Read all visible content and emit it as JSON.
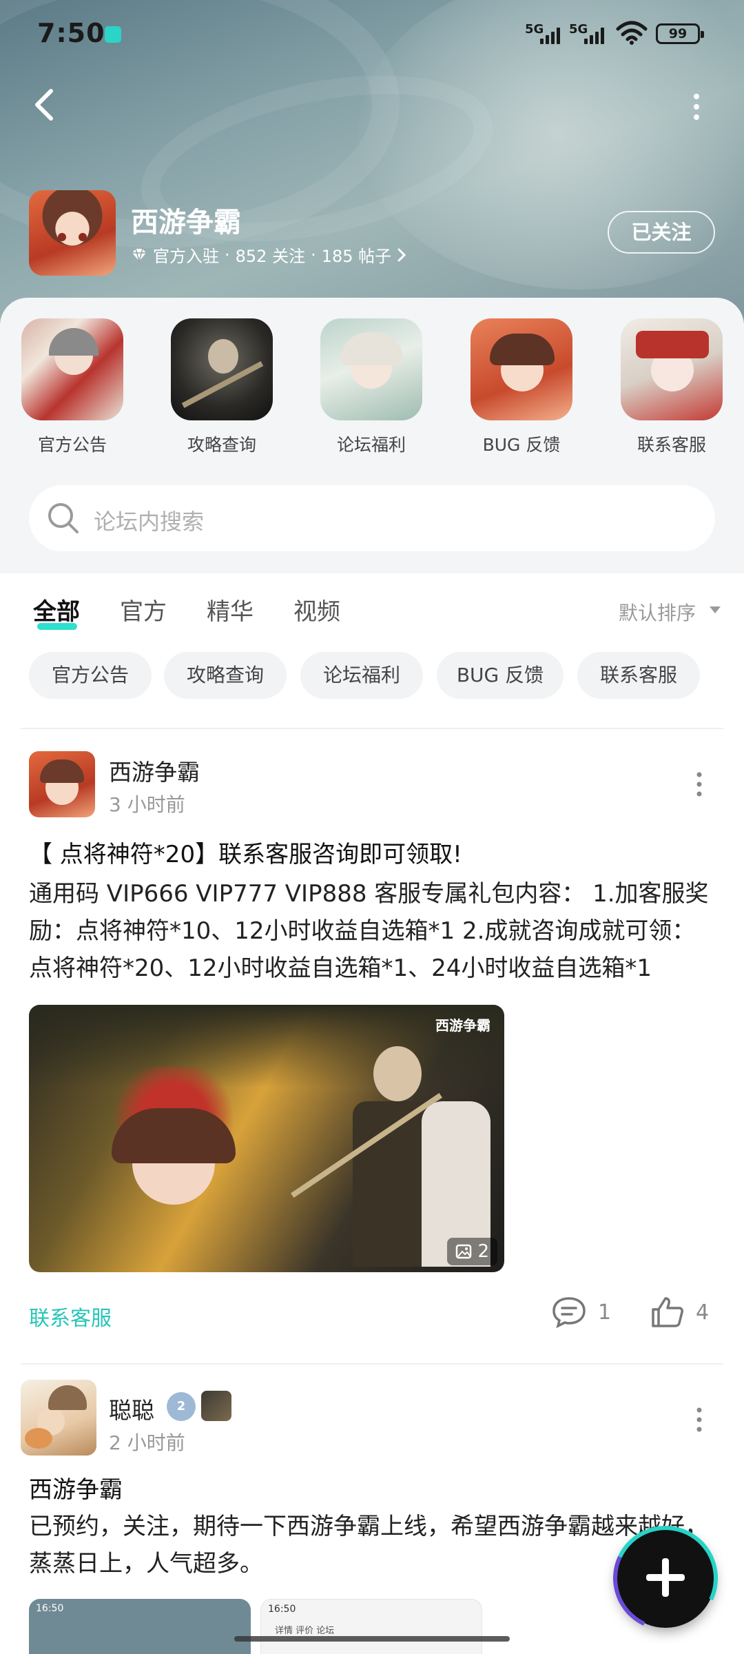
{
  "status_bar": {
    "time": "7:50",
    "signal1": "5G",
    "signal2": "5G",
    "battery": "99"
  },
  "header": {
    "forum_title": "西游争霸",
    "official_label": "官方入驻",
    "followers": "852 关注",
    "posts": "185 帖子",
    "follow_button": "已关注",
    "separator": "·"
  },
  "categories": [
    {
      "label": "官方公告",
      "color": "#c98a7c"
    },
    {
      "label": "攻略查询",
      "color": "#2a2a2a"
    },
    {
      "label": "论坛福利",
      "color": "#c6d8cf"
    },
    {
      "label": "BUG 反馈",
      "color": "#d66a48"
    },
    {
      "label": "联系客服",
      "color": "#e8e0d8"
    }
  ],
  "search": {
    "placeholder": "论坛内搜索"
  },
  "tabs": {
    "items": [
      "全部",
      "官方",
      "精华",
      "视频"
    ],
    "active": "全部",
    "sort_label": "默认排序"
  },
  "chips": [
    "官方公告",
    "攻略查询",
    "论坛福利",
    "BUG 反馈",
    "联系客服"
  ],
  "posts": [
    {
      "author": "西游争霸",
      "time": "3 小时前",
      "title": "【 点将神符*20】联系客服咨询即可领取!",
      "body": "通用码 VIP666 VIP777 VIP888 客服专属礼包内容： 1.加客服奖励：点将神符*10、12小时收益自选箱*1 2.成就咨询成就可领： 点将神符*20、12小时收益自选箱*1、24小时收益自选箱*1",
      "image_count": "2",
      "image_watermark": "西游争霸",
      "tag": "联系客服",
      "comments": "1",
      "likes": "4"
    },
    {
      "author": "聪聪",
      "time": "2 小时前",
      "level": "2",
      "title": "西游争霸",
      "body": "已预约，关注，期待一下西游争霸上线，希望西游争霸越来越好，蒸蒸日上，人气超多。",
      "thumbs": [
        {
          "time": "16:50",
          "tabs": ""
        },
        {
          "time": "16:50",
          "tabs": "详情  评价  论坛"
        }
      ]
    }
  ],
  "colors": {
    "accent": "#2ee0cf",
    "tag": "#27c6b8"
  }
}
